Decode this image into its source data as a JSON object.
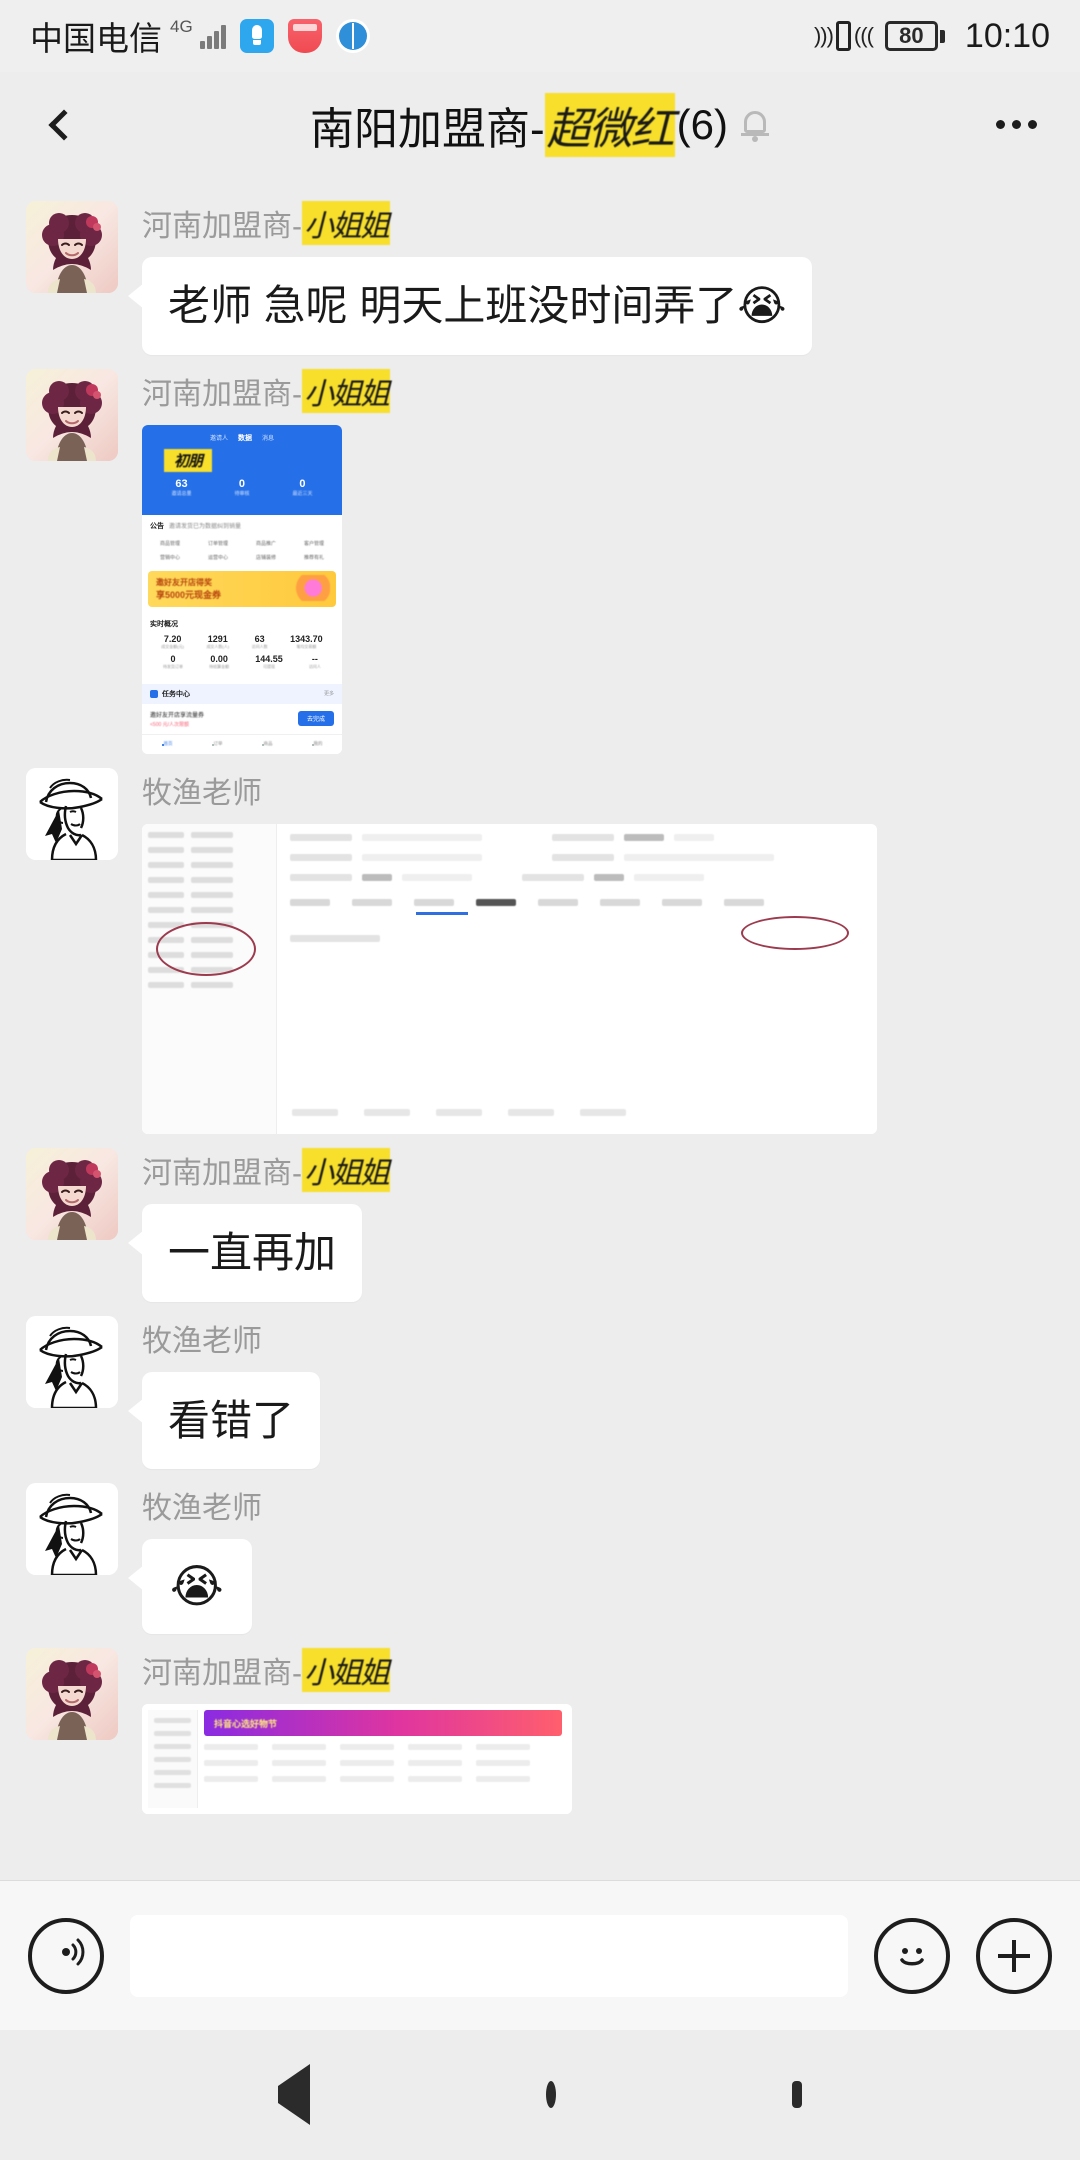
{
  "status_bar": {
    "carrier": "中国电信",
    "network": "4G",
    "signal_icon": "signal-bars-icon",
    "app_icons": [
      "blue-app-icon",
      "red-app-icon",
      "globe-app-icon"
    ],
    "vibrate_icon": "vibrate-icon",
    "battery_level": "80",
    "time": "10:10"
  },
  "nav": {
    "back_icon": "back-chevron-icon",
    "title_prefix": "南阳加盟商-",
    "title_redacted": "超微红",
    "member_count": "(6)",
    "mute_icon": "bell-muted-icon",
    "more_icon": "more-options-icon"
  },
  "chat": {
    "messages": [
      {
        "id": "m1",
        "sender_prefix": "河南加盟商-",
        "sender_redacted": "小姐姐",
        "avatar": "anime-girl-avatar",
        "type": "text",
        "text": "老师 急呢 明天上班没时间弄了😭"
      },
      {
        "id": "m2",
        "sender_prefix": "河南加盟商-",
        "sender_redacted": "小姐姐",
        "avatar": "anime-girl-avatar",
        "type": "image",
        "image": "dashboard-screenshot",
        "image_content": {
          "header_tabs": [
            "邀请人",
            "数据",
            "消息"
          ],
          "header_title_redacted": "初朋",
          "header_stats": [
            {
              "value": "63",
              "label": "邀请总量"
            },
            {
              "value": "0",
              "label": "待审核"
            },
            {
              "value": "0",
              "label": "最近三天"
            }
          ],
          "notice_tag": "公告",
          "notice_text": "邀请发货已为数据纠到销量",
          "grid_icons": [
            "商品管理",
            "订单管理",
            "商品推广",
            "客户管理",
            "营销中心",
            "运营中心",
            "店铺装修",
            "推荐有礼"
          ],
          "promo_line1": "邀好友开店得奖",
          "promo_line2": "享5000元现金券",
          "realtime_title": "实时概况",
          "realtime_stats": [
            {
              "value": "7.20",
              "unit": "万",
              "label": "成交金额(元)"
            },
            {
              "value": "1291",
              "unit": "",
              "label": "成交人数(人)"
            },
            {
              "value": "63",
              "unit": "",
              "label": "访问人数"
            },
            {
              "value": "1343.70",
              "unit": "",
              "label": "笔均交易额"
            },
            {
              "value": "0",
              "unit": "",
              "label": "待发货订单"
            },
            {
              "value": "0.00",
              "unit": "",
              "label": "待结算金额"
            },
            {
              "value": "144.55",
              "unit": "",
              "label": "可提现"
            },
            {
              "value": "--",
              "unit": "",
              "label": "访问人"
            }
          ],
          "task_center": "任务中心",
          "task_more": "更多",
          "task_item": "邀好友开店享流量券",
          "task_sub": "<500 元/人次限额",
          "task_button": "去完成",
          "tab_bar": [
            "首页",
            "订单",
            "商品",
            "我的"
          ]
        }
      },
      {
        "id": "m3",
        "sender": "牧渔老师",
        "avatar": "cowboy-line-art-avatar",
        "type": "image",
        "image": "erp-form-screenshot",
        "annotation": "red-circle-highlight"
      },
      {
        "id": "m4",
        "sender_prefix": "河南加盟商-",
        "sender_redacted": "小姐姐",
        "avatar": "anime-girl-avatar",
        "type": "text",
        "text": "一直再加"
      },
      {
        "id": "m5",
        "sender": "牧渔老师",
        "avatar": "cowboy-line-art-avatar",
        "type": "text",
        "text": "看错了"
      },
      {
        "id": "m6",
        "sender": "牧渔老师",
        "avatar": "cowboy-line-art-avatar",
        "type": "emoji",
        "text": "😭"
      },
      {
        "id": "m7",
        "sender_prefix": "河南加盟商-",
        "sender_redacted": "小姐姐",
        "avatar": "anime-girl-avatar",
        "type": "image",
        "image": "promo-banner-screenshot",
        "image_content": {
          "banner_text": "抖音心选好物节"
        }
      }
    ]
  },
  "input_bar": {
    "voice_icon": "voice-input-icon",
    "input_value": "",
    "input_placeholder": "",
    "emoji_icon": "emoji-smile-icon",
    "plus_icon": "add-plus-icon"
  },
  "system_nav": {
    "back_icon": "system-back-triangle-icon",
    "home_icon": "system-home-circle-icon",
    "recents_icon": "system-recents-square-icon"
  },
  "colors": {
    "chat_bg": "#ededed",
    "bubble_bg": "#ffffff",
    "redact_highlight": "#f7df2b",
    "accent_blue": "#2570e8"
  }
}
